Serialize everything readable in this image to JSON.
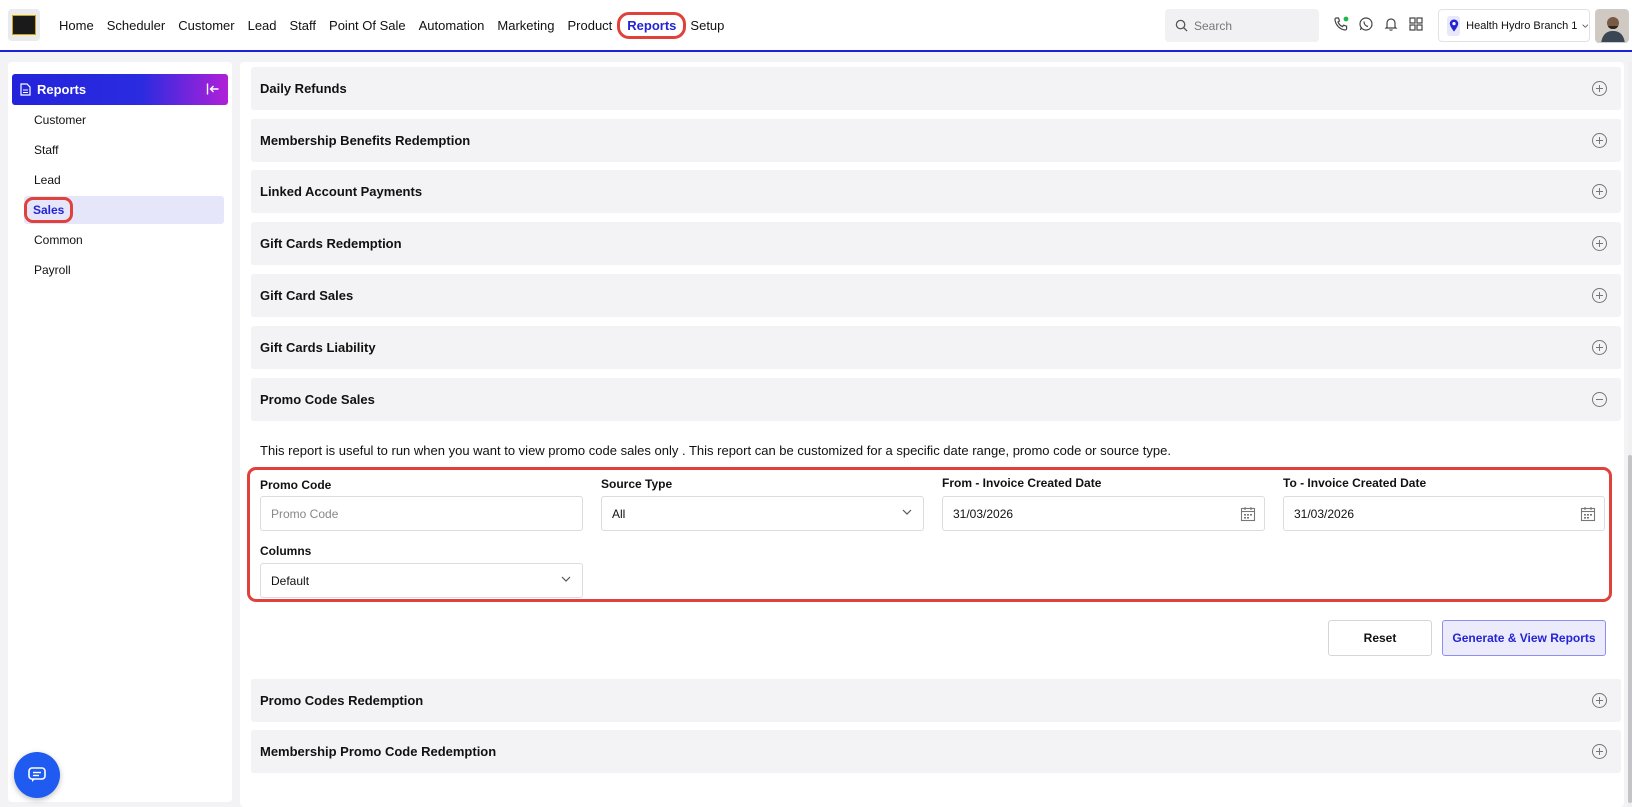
{
  "nav": {
    "items": [
      "Home",
      "Scheduler",
      "Customer",
      "Lead",
      "Staff",
      "Point Of Sale",
      "Automation",
      "Marketing",
      "Product"
    ],
    "active": "Reports",
    "after": [
      "Setup"
    ]
  },
  "search": {
    "placeholder": "Search"
  },
  "branch": {
    "name": "Health Hydro Branch 1"
  },
  "sidebar": {
    "title": "Reports",
    "items": [
      "Customer",
      "Staff",
      "Lead",
      "Sales",
      "Common",
      "Payroll"
    ],
    "active": "Sales"
  },
  "sections": {
    "before": [
      "Daily Refunds",
      "Membership Benefits Redemption",
      "Linked Account Payments",
      "Gift Cards Redemption",
      "Gift Card Sales",
      "Gift Cards Liability"
    ],
    "open": "Promo Code Sales",
    "after": [
      "Promo Codes Redemption",
      "Membership Promo Code Redemption"
    ]
  },
  "report": {
    "description": "This report is useful to run when you want to view promo code sales only . This report can be customized for a specific date range, promo code or source type.",
    "promo_code": {
      "label": "Promo Code",
      "placeholder": "Promo Code"
    },
    "source_type": {
      "label": "Source Type",
      "value": "All"
    },
    "from_date": {
      "label": "From - Invoice Created Date",
      "value": "31/03/2026"
    },
    "to_date": {
      "label": "To - Invoice Created Date",
      "value": "31/03/2026"
    },
    "columns": {
      "label": "Columns",
      "value": "Default"
    }
  },
  "buttons": {
    "reset": "Reset",
    "generate": "Generate & View Reports"
  },
  "colors": {
    "accent": "#2424d6",
    "highlight": "#e0413a",
    "chat": "#1f5bf0"
  }
}
